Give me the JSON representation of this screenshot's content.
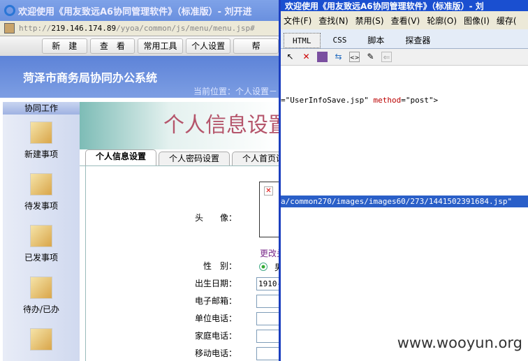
{
  "left_window": {
    "title": "欢迎使用《用友致远A6协同管理软件》（标准版）- 刘开进",
    "address": {
      "scheme": "http://",
      "host": "219.146.174.89",
      "path": "/yyoa/common/js/menu/menu.jsp#"
    },
    "top_nav": [
      "新　建",
      "查　看",
      "常用工具",
      "个人设置",
      "帮"
    ],
    "system_name": "菏泽市商务局协同办公系统",
    "location": "当前位置：个人设置－",
    "sidebar": {
      "header": "协同工作",
      "items": [
        {
          "label": "新建事项"
        },
        {
          "label": "待发事项"
        },
        {
          "label": "已发事项"
        },
        {
          "label": "待办/已办"
        },
        {
          "label": ""
        }
      ]
    },
    "page_heading": "个人信息设置",
    "tabs": [
      {
        "label": "个人信息设置",
        "active": true
      },
      {
        "label": "个人密码设置"
      },
      {
        "label": "个人首页设"
      }
    ],
    "form": {
      "avatar_label": "头　　像：",
      "change_link": "更改头",
      "gender_label": "性　别：",
      "gender_value": "男",
      "birth_label": "出生日期：",
      "birth_value": "1910-",
      "email_label": "电子邮箱：",
      "work_phone_label": "单位电话：",
      "home_phone_label": "家庭电话：",
      "mobile_label": "移动电话："
    }
  },
  "right_window": {
    "title": "欢迎使用《用友致远A6协同管理软件》（标准版）- 刘",
    "menu": [
      "文件(F)",
      "查找(N)",
      "禁用(S)",
      "查看(V)",
      "轮廓(O)",
      "图像(I)",
      "缓存("
    ],
    "tabs": [
      {
        "label": "HTML",
        "active": true
      },
      {
        "label": "CSS"
      },
      {
        "label": "脚本"
      },
      {
        "label": "探查器"
      }
    ],
    "code_line": {
      "pre": "=\"UserInfoSave.jsp\" ",
      "attr": "method",
      "post": "=\"post\">"
    },
    "selected_line": "a/common270/images/images60/273/1441502391684.jsp\""
  },
  "watermark": "www.wooyun.org"
}
